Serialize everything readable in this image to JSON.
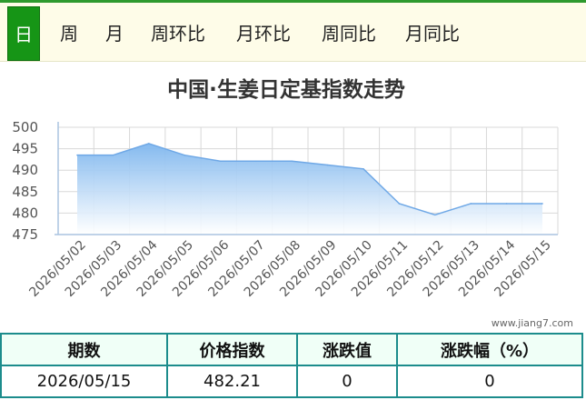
{
  "tabs": [
    {
      "label": "日",
      "active": true
    },
    {
      "label": "周",
      "active": false
    },
    {
      "label": "月",
      "active": false
    },
    {
      "label": "周环比",
      "active": false
    },
    {
      "label": "月环比",
      "active": false
    },
    {
      "label": "周同比",
      "active": false
    },
    {
      "label": "月同比",
      "active": false
    }
  ],
  "watermark": "www.jiang7.com",
  "chart_data": {
    "type": "area",
    "title": "中国·生姜日定基指数走势",
    "xlabel": "",
    "ylabel": "",
    "x": [
      "2026/05/02",
      "2026/05/03",
      "2026/05/04",
      "2026/05/05",
      "2026/05/06",
      "2026/05/07",
      "2026/05/08",
      "2026/05/09",
      "2026/05/10",
      "2026/05/11",
      "2026/05/12",
      "2026/05/13",
      "2026/05/14",
      "2026/05/15"
    ],
    "values": [
      493.5,
      493.5,
      496.2,
      493.5,
      492.1,
      492.1,
      492.1,
      491.2,
      490.3,
      482.2,
      479.6,
      482.21,
      482.21,
      482.21
    ],
    "ylim": [
      475,
      500
    ],
    "yticks": [
      475,
      480,
      485,
      490,
      495,
      500
    ],
    "grid": true,
    "colors": {
      "fill_top": "#7eb6ee",
      "fill_bottom": "#ffffff",
      "line": "#6fa8e6",
      "grid": "#d8d8d8",
      "axis": "#aac4e0"
    }
  },
  "table": {
    "headers": [
      "期数",
      "价格指数",
      "涨跌值",
      "涨跌幅（%）"
    ],
    "row": [
      "2026/05/15",
      "482.21",
      "0",
      "0"
    ]
  }
}
